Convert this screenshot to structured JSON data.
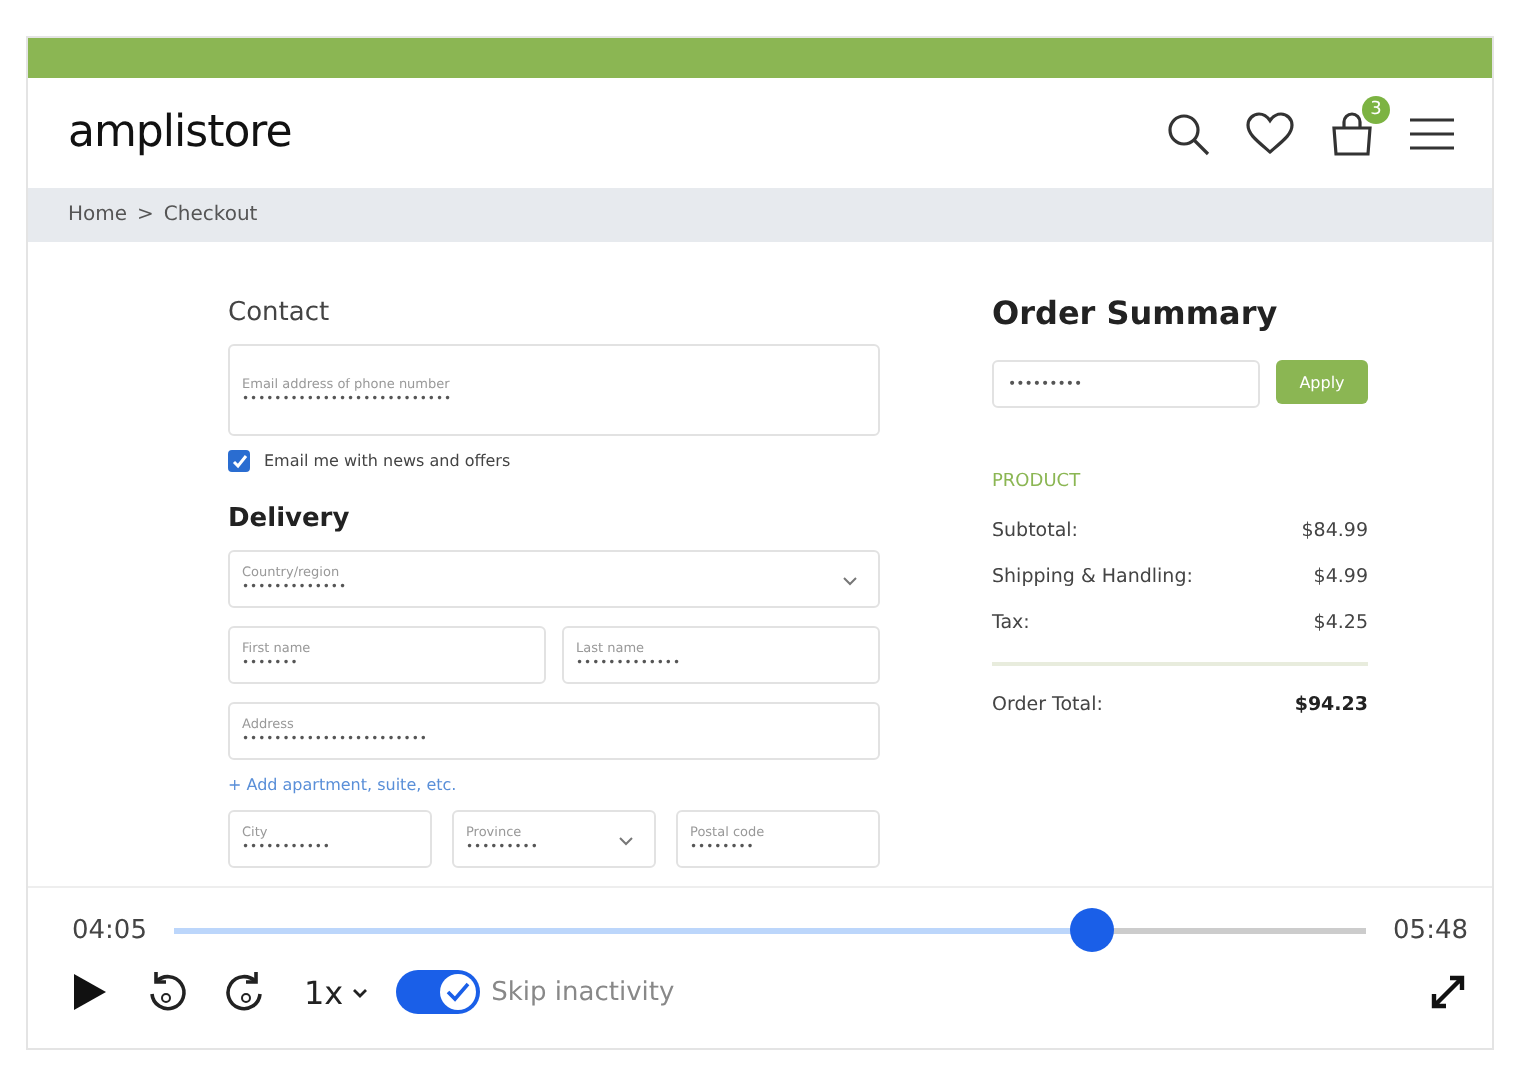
{
  "header": {
    "logo": "amplistore",
    "cart_count": "3"
  },
  "breadcrumb": [
    "Home",
    ">",
    "Checkout"
  ],
  "contact": {
    "title": "Contact",
    "email": {
      "placeholder": "Email address of phone number",
      "value": "••••••••••••••••••••••••••"
    },
    "newsletter": {
      "label": "Email me with news and offers",
      "checked": true
    }
  },
  "delivery": {
    "title": "Delivery",
    "rows": [
      [
        {
          "placeholder": "Country/region",
          "value": "•••••••••••••",
          "kind": "select"
        }
      ],
      [
        {
          "placeholder": "First name",
          "value": "•••••••",
          "kind": "text"
        },
        {
          "placeholder": "Last name",
          "value": "•••••••••••••",
          "kind": "text"
        }
      ],
      [
        {
          "placeholder": "Address",
          "value": "•••••••••••••••••••••••",
          "kind": "text"
        }
      ]
    ],
    "add_link": "+ Add apartment, suite, etc.",
    "bottom_row": [
      {
        "placeholder": "City",
        "value": "•••••••••••",
        "kind": "text"
      },
      {
        "placeholder": "Province",
        "value": "•••••••••",
        "kind": "select"
      },
      {
        "placeholder": "Postal code",
        "value": "••••••••",
        "kind": "text"
      }
    ]
  },
  "summary": {
    "title": "Order Summary",
    "code_value": "•••••••••",
    "apply": "Apply",
    "section": "PRODUCT",
    "lines": [
      {
        "label": "Subtotal:",
        "value": "$84.99"
      },
      {
        "label": "Shipping & Handling:",
        "value": "$4.99"
      },
      {
        "label": "Tax:",
        "value": "$4.25"
      }
    ],
    "total": {
      "label": "Order Total:",
      "value": "$94.23"
    }
  },
  "player": {
    "elapsed": "04:05",
    "duration": "05:48",
    "level": 0.77,
    "speed": "1x",
    "skip": {
      "label": "Skip inactivity",
      "on": true
    }
  }
}
